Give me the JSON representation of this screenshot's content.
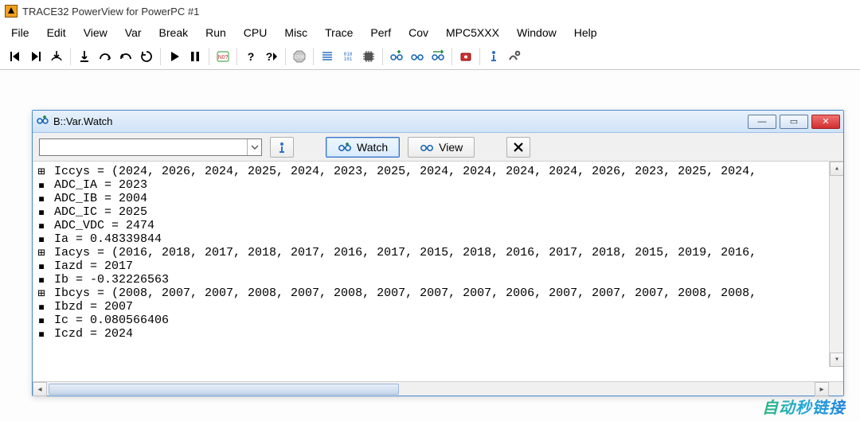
{
  "app": {
    "title": "TRACE32 PowerView for PowerPC #1"
  },
  "menu": {
    "items": [
      "File",
      "Edit",
      "View",
      "Var",
      "Break",
      "Run",
      "CPU",
      "Misc",
      "Trace",
      "Perf",
      "Cov",
      "MPC5XXX",
      "Window",
      "Help"
    ]
  },
  "toolbar": {
    "groups": [
      [
        "step-back-to-start",
        "step-back",
        "step-cursor"
      ],
      [
        "step-into",
        "step-over",
        "step-return",
        "restart"
      ],
      [
        "run",
        "pause"
      ],
      [
        "toggle-breakpoint"
      ],
      [
        "help",
        "context-help"
      ],
      [
        "stop"
      ],
      [
        "list",
        "binary",
        "chip"
      ],
      [
        "watch-add",
        "watch-view",
        "watch-stream"
      ],
      [
        "record"
      ],
      [
        "info",
        "settings"
      ]
    ],
    "icon_labels": {
      "step-back-to-start": "▮◀",
      "step-back": "▶▮",
      "step-cursor": "↓⌄",
      "step-into": "↓",
      "step-over": "↻",
      "step-return": "↷",
      "restart": "⟳",
      "run": "▶",
      "pause": "❚❚",
      "toggle-breakpoint": "⎋",
      "help": "?",
      "context-help": "?▸",
      "stop": "STOP",
      "list": "≣",
      "binary": "010",
      "chip": "▥",
      "watch-add": "👓+",
      "watch-view": "👓",
      "watch-stream": "👓→",
      "record": "◉",
      "info": "ℹ",
      "settings": "🔧"
    }
  },
  "watchWindow": {
    "icon": "glasses-plus-icon",
    "title": "B::Var.Watch",
    "controls": {
      "min": "—",
      "max": "▭",
      "close": "✕"
    },
    "toolbar": {
      "combo_value": "",
      "info_icon": "ℹ",
      "watch_label": "Watch",
      "view_label": "View",
      "delete_icon": "✖"
    },
    "rows": [
      {
        "twist": "⊞",
        "name": "Iccys",
        "text": "Iccys = (2024, 2026, 2024, 2025, 2024, 2023, 2025, 2024, 2024, 2024, 2024, 2026, 2023, 2025, 2024,"
      },
      {
        "twist": "▪",
        "name": "ADC_IA",
        "text": "ADC_IA = 2023"
      },
      {
        "twist": "▪",
        "name": "ADC_IB",
        "text": "ADC_IB = 2004"
      },
      {
        "twist": "▪",
        "name": "ADC_IC",
        "text": "ADC_IC = 2025"
      },
      {
        "twist": "▪",
        "name": "ADC_VDC",
        "text": "ADC_VDC = 2474"
      },
      {
        "twist": "▪",
        "name": "Ia",
        "text": "Ia = 0.48339844"
      },
      {
        "twist": "⊞",
        "name": "Iacys",
        "text": "Iacys = (2016, 2018, 2017, 2018, 2017, 2016, 2017, 2015, 2018, 2016, 2017, 2018, 2015, 2019, 2016,"
      },
      {
        "twist": "▪",
        "name": "Iazd",
        "text": "Iazd = 2017"
      },
      {
        "twist": "▪",
        "name": "Ib",
        "text": "Ib = -0.32226563"
      },
      {
        "twist": "⊞",
        "name": "Ibcys",
        "text": "Ibcys = (2008, 2007, 2007, 2008, 2007, 2008, 2007, 2007, 2007, 2006, 2007, 2007, 2007, 2008, 2008,"
      },
      {
        "twist": "▪",
        "name": "Ibzd",
        "text": "Ibzd = 2007"
      },
      {
        "twist": "▪",
        "name": "Ic",
        "text": "Ic = 0.080566406"
      },
      {
        "twist": "▪",
        "name": "Iczd",
        "text": "Iczd = 2024"
      }
    ]
  },
  "watermark": "自动秒链接"
}
